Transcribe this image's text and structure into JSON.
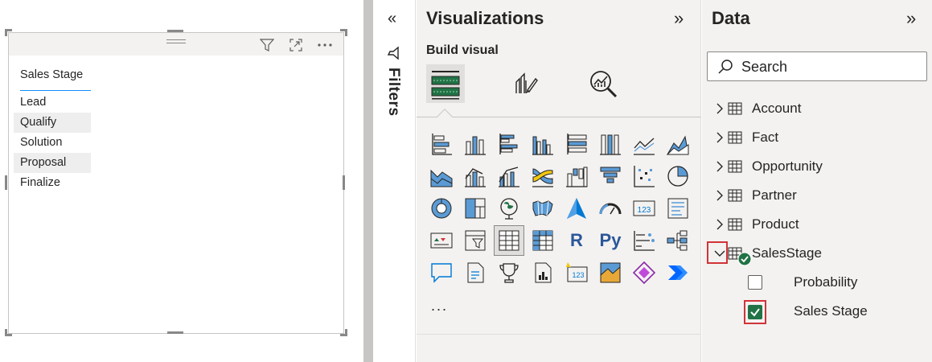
{
  "visual": {
    "column_header": "Sales Stage",
    "rows": [
      "Lead",
      "Qualify",
      "Solution",
      "Proposal",
      "Finalize"
    ]
  },
  "filters": {
    "label": "Filters",
    "collapse_glyph": "«"
  },
  "visualizations": {
    "title": "Visualizations",
    "expand_glyph": "»",
    "build_label": "Build visual",
    "more_label": "...",
    "icons": [
      "stacked-bar-chart-icon",
      "stacked-column-chart-icon",
      "clustered-bar-chart-icon",
      "clustered-column-chart-icon",
      "100-stacked-bar-chart-icon",
      "100-stacked-column-chart-icon",
      "line-chart-icon",
      "area-chart-icon",
      "stacked-area-chart-icon",
      "line-stacked-column-chart-icon",
      "line-clustered-column-chart-icon",
      "ribbon-chart-icon",
      "waterfall-chart-icon",
      "funnel-chart-icon",
      "scatter-chart-icon",
      "pie-chart-icon",
      "donut-chart-icon",
      "treemap-icon",
      "map-icon",
      "filled-map-icon",
      "azure-map-icon",
      "gauge-icon",
      "card-icon",
      "multi-row-card-icon",
      "kpi-icon",
      "slicer-icon",
      "table-icon",
      "matrix-icon",
      "r-visual-icon",
      "python-visual-icon",
      "key-influencers-icon",
      "decomposition-tree-icon",
      "qa-icon",
      "smart-narrative-icon",
      "goals-icon",
      "paginated-report-icon",
      "new-card-icon",
      "arcgis-map-icon",
      "power-apps-icon",
      "power-automate-icon"
    ],
    "r_label": "R",
    "py_label": "Py",
    "card_label": "123"
  },
  "data_pane": {
    "title": "Data",
    "expand_glyph": "»",
    "search_placeholder": "Search",
    "tables": [
      "Account",
      "Fact",
      "Opportunity",
      "Partner",
      "Product",
      "SalesStage"
    ],
    "fields": [
      {
        "name": "Probability",
        "checked": false
      },
      {
        "name": "Sales Stage",
        "checked": true
      }
    ]
  },
  "colors": {
    "accent": "#118dff",
    "check": "#217346",
    "highlight": "#d13438"
  }
}
